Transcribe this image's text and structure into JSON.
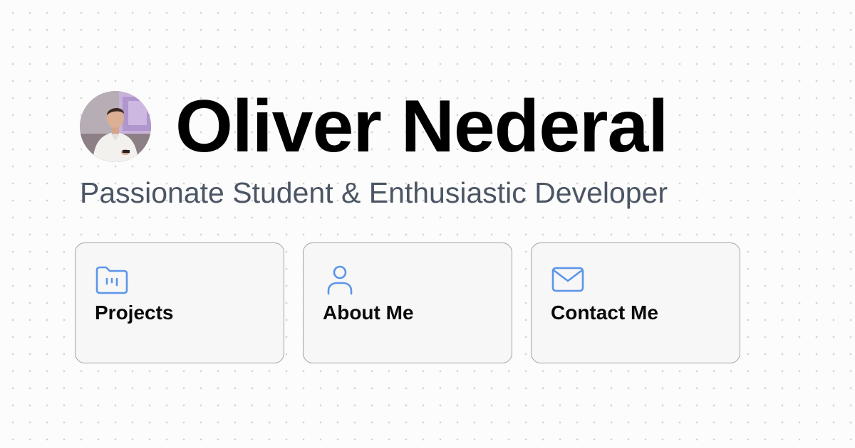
{
  "profile": {
    "name": "Oliver Nederal",
    "tagline": "Passionate Student & Enthusiastic Developer",
    "avatar_icon": "profile-photo"
  },
  "nav_cards": [
    {
      "label": "Projects",
      "icon": "folder-icon"
    },
    {
      "label": "About Me",
      "icon": "user-icon"
    },
    {
      "label": "Contact Me",
      "icon": "mail-icon"
    }
  ],
  "colors": {
    "background": "#fcfcfc",
    "dot": "#d4d4d4",
    "title": "#000000",
    "tagline": "#4b5563",
    "card_background": "#f7f7f7",
    "card_border": "#a3a3a3",
    "icon_accent": "#5b95ea"
  }
}
